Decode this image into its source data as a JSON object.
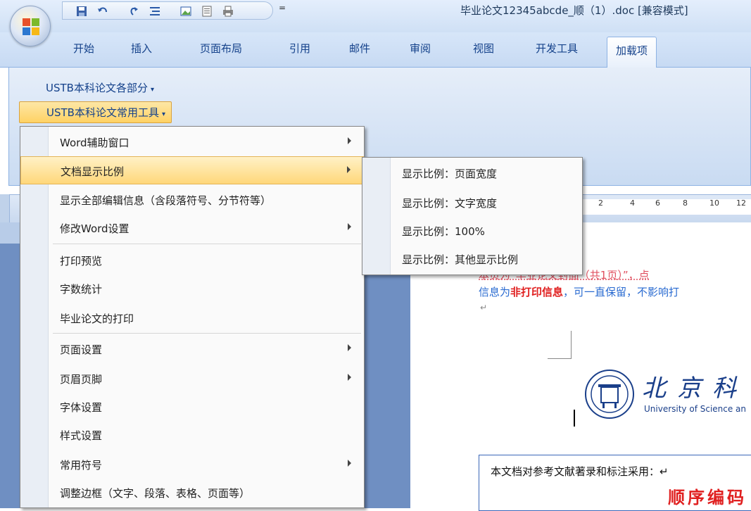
{
  "titlebar": {
    "doc_title": "毕业论文12345abcde_顺（1）.doc [兼容模式]",
    "quick_access": [
      "save-icon",
      "undo-icon",
      "redo-icon",
      "list-icon",
      "image-icon",
      "page-icon",
      "print-icon"
    ],
    "more_glyph": "="
  },
  "tabs": [
    {
      "label": "开始"
    },
    {
      "label": "插入"
    },
    {
      "label": "页面布局"
    },
    {
      "label": "引用"
    },
    {
      "label": "邮件"
    },
    {
      "label": "审阅"
    },
    {
      "label": "视图"
    },
    {
      "label": "开发工具"
    },
    {
      "label": "加载项",
      "active": true
    }
  ],
  "ribbon": {
    "parts_label": "USTB本科论文各部分",
    "tools_label": "USTB本科论文常用工具",
    "dropdown_glyph": "▾"
  },
  "menu": {
    "items": [
      {
        "label": "Word辅助窗口",
        "submenu": true
      },
      {
        "label": "文档显示比例",
        "submenu": true,
        "highlighted": true
      },
      {
        "label": "显示全部编辑信息（含段落符号、分节符等）",
        "submenu": false
      },
      {
        "label": "修改Word设置",
        "submenu": true
      },
      {
        "label": "打印预览",
        "submenu": false
      },
      {
        "label": "字数统计",
        "submenu": false
      },
      {
        "label": "毕业论文的打印",
        "submenu": false
      },
      {
        "label": "页面设置",
        "submenu": true
      },
      {
        "label": "页眉页脚",
        "submenu": true
      },
      {
        "label": "字体设置",
        "submenu": false
      },
      {
        "label": "样式设置",
        "submenu": false
      },
      {
        "label": "常用符号",
        "submenu": true
      },
      {
        "label": "调整边框（文字、段落、表格、页面等）",
        "submenu": false
      }
    ]
  },
  "submenu": {
    "items": [
      {
        "label": "显示比例：页面宽度"
      },
      {
        "label": "显示比例：文字宽度"
      },
      {
        "label": "显示比例：100%"
      },
      {
        "label": "显示比例：其他显示比例"
      }
    ]
  },
  "ruler": {
    "numbers": [
      "2",
      "4",
      "6",
      "8",
      "10",
      "12"
    ]
  },
  "document": {
    "note_line1_a": "本页为“毕业论文封面（共1页）”，点",
    "note_line2_a": "信息为",
    "note_line2_b": "非打印信息",
    "note_line2_c": "，可一直保留，不影响打",
    "para_mark": "↵",
    "univ_cn": "北京科",
    "univ_en": "University of Science an",
    "ref_line": "本文档对参考文献著录和标注采用：↵",
    "ref_big": "顺序编码"
  },
  "colors": {
    "accent": "#15428b",
    "menu_highlight": "#ffd77a",
    "doc_bg": "#6f8fc2",
    "note_red": "#e02020"
  }
}
